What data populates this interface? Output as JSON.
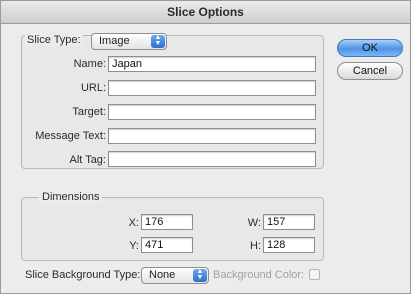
{
  "window": {
    "title": "Slice Options"
  },
  "slice_type": {
    "label": "Slice Type:",
    "value": "Image"
  },
  "fields": {
    "name": {
      "label": "Name:",
      "value": "Japan"
    },
    "url": {
      "label": "URL:",
      "value": ""
    },
    "target": {
      "label": "Target:",
      "value": ""
    },
    "message_text": {
      "label": "Message Text:",
      "value": ""
    },
    "alt_tag": {
      "label": "Alt Tag:",
      "value": ""
    }
  },
  "dimensions": {
    "label": "Dimensions",
    "x": {
      "label": "X:",
      "value": "176"
    },
    "y": {
      "label": "Y:",
      "value": "471"
    },
    "w": {
      "label": "W:",
      "value": "157"
    },
    "h": {
      "label": "H:",
      "value": "128"
    }
  },
  "background": {
    "type_label": "Slice Background Type:",
    "type_value": "None",
    "color_label": "Background Color:"
  },
  "buttons": {
    "ok": "OK",
    "cancel": "Cancel"
  },
  "icons": {
    "popup_arrows": "updown-arrows-icon"
  }
}
